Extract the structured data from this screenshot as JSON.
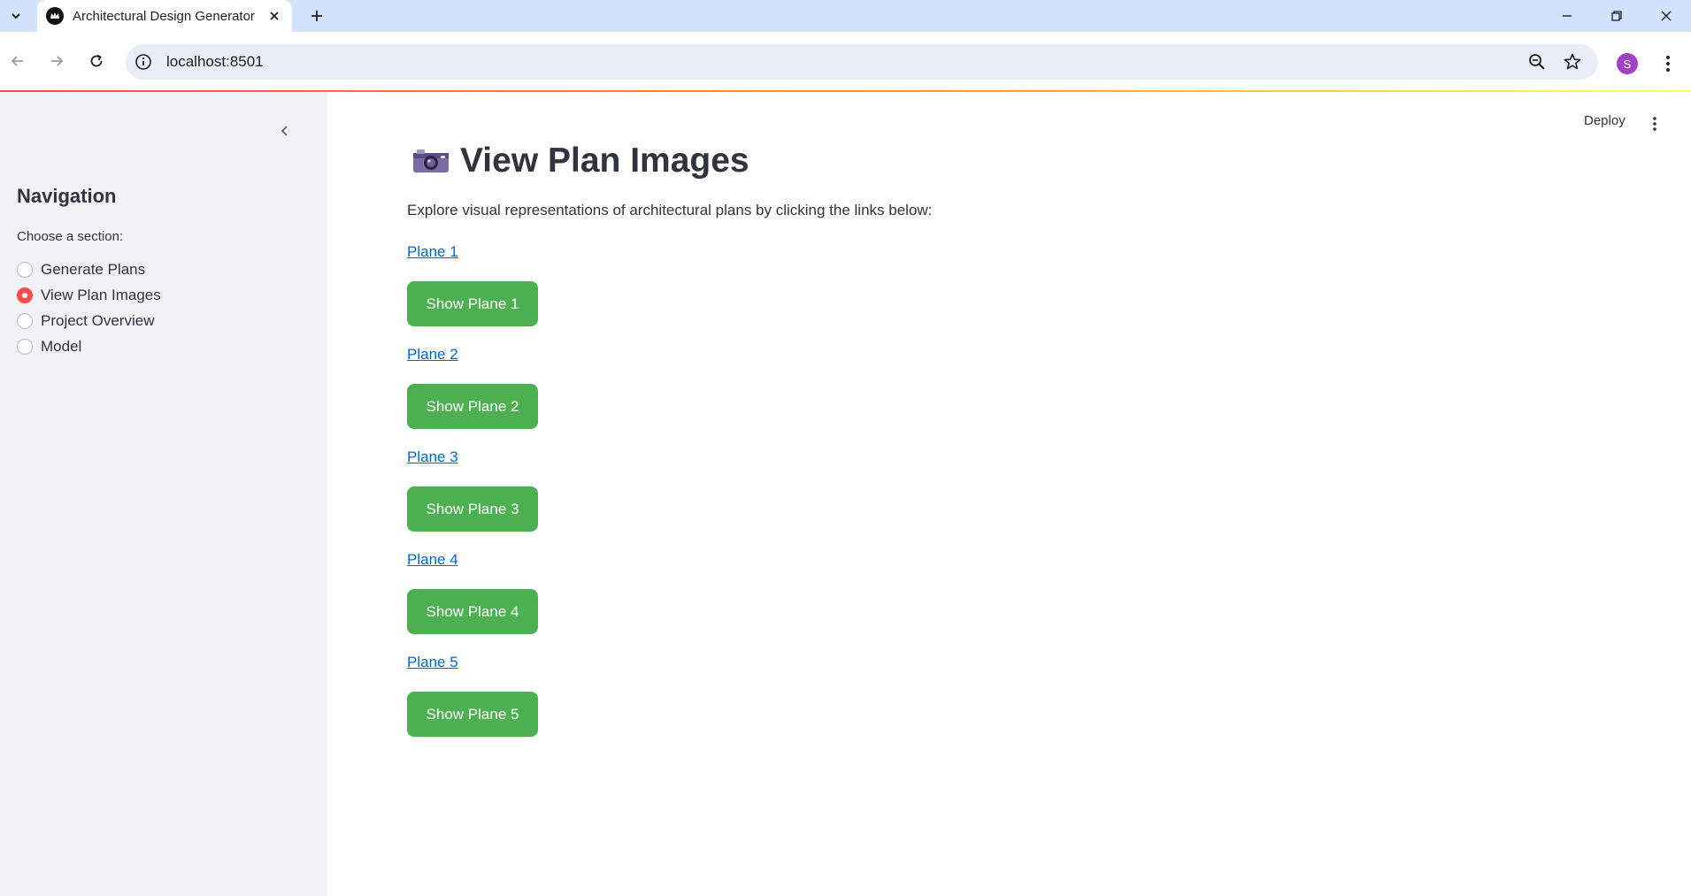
{
  "browser": {
    "tab_title": "Architectural Design Generator",
    "url": "localhost:8501",
    "profile_initial": "S"
  },
  "app": {
    "deploy_label": "Deploy",
    "sidebar": {
      "title": "Navigation",
      "radio_label": "Choose a section:",
      "options": [
        {
          "label": "Generate Plans",
          "selected": false
        },
        {
          "label": "View Plan Images",
          "selected": true
        },
        {
          "label": "Project Overview",
          "selected": false
        },
        {
          "label": "Model",
          "selected": false
        }
      ]
    },
    "main": {
      "title": "View Plan Images",
      "intro": "Explore visual representations of architectural plans by clicking the links below:",
      "plans": [
        {
          "link": "Plane 1",
          "button": "Show Plane 1"
        },
        {
          "link": "Plane 2",
          "button": "Show Plane 2"
        },
        {
          "link": "Plane 3",
          "button": "Show Plane 3"
        },
        {
          "link": "Plane 4",
          "button": "Show Plane 4"
        },
        {
          "link": "Plane 5",
          "button": "Show Plane 5"
        }
      ]
    }
  },
  "colors": {
    "accent": "#ff4b4b",
    "button_green": "#4caf50",
    "link_blue": "#0068c9",
    "sidebar_bg": "#f0f2f6"
  }
}
